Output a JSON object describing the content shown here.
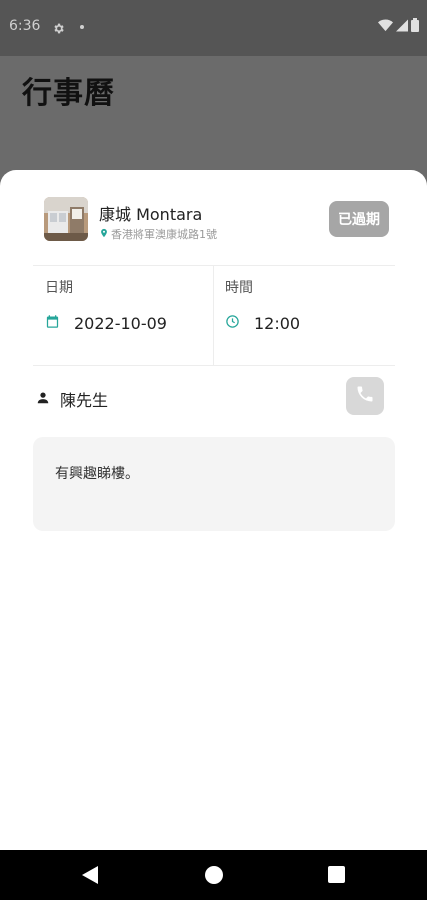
{
  "status_bar": {
    "time": "6:36",
    "icons": [
      "gear-icon",
      "notification-dot-icon",
      "wifi-icon",
      "signal-icon",
      "battery-icon"
    ]
  },
  "page": {
    "title": "行事曆"
  },
  "appointment": {
    "property_name": "康城 Montara",
    "property_address": "香港將軍澳康城路1號",
    "status_badge": "已過期",
    "date_label": "日期",
    "date_value": "2022-10-09",
    "time_label": "時間",
    "time_value": "12:00",
    "contact_name": "陳先生",
    "note": "有興趣睇樓。"
  },
  "colors": {
    "accent": "#26a69a",
    "badge_bg": "#a6a6a6",
    "phone_button_bg": "#d8d8d8",
    "note_bg": "#f4f4f4",
    "scrim": "#6b6b6b"
  }
}
